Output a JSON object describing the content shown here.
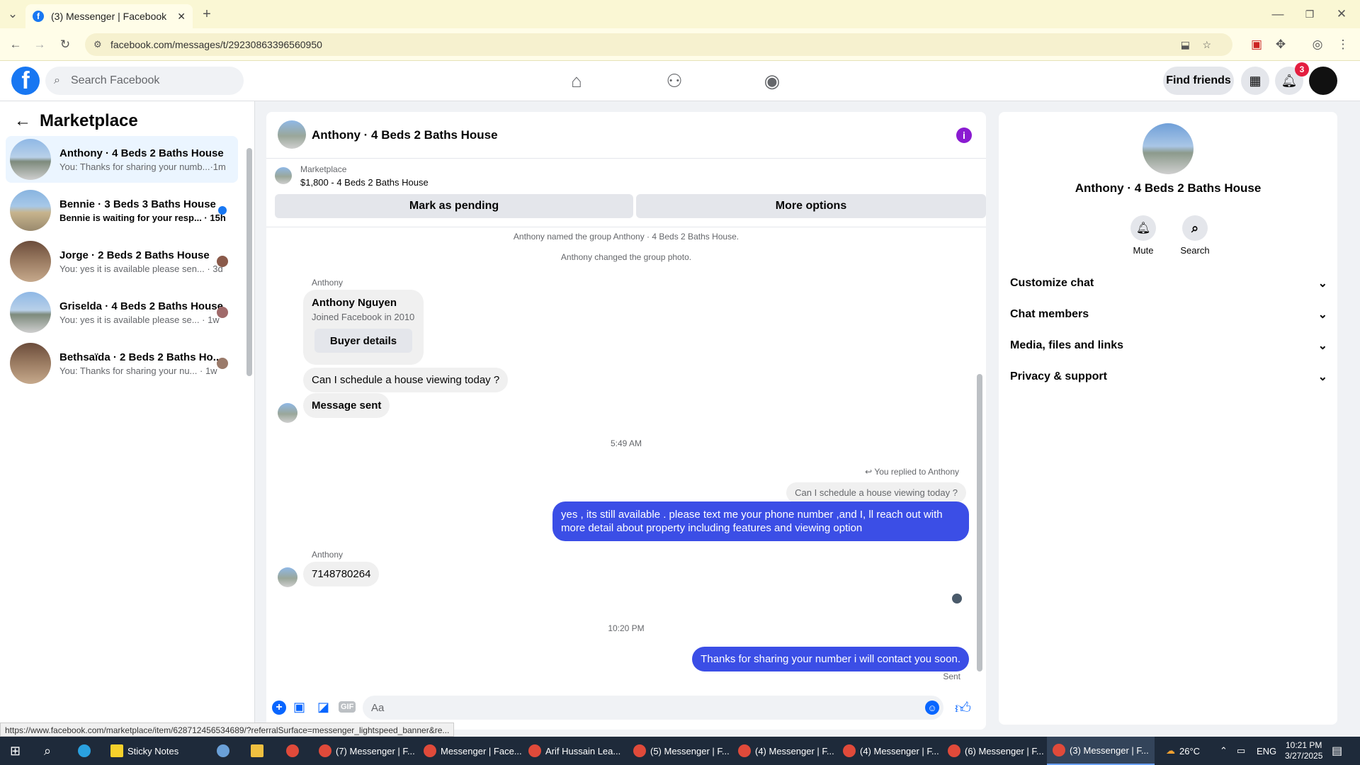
{
  "browser": {
    "tab_title": "(3) Messenger | Facebook",
    "url": "facebook.com/messages/t/29230863396560950",
    "status_url": "https://www.facebook.com/marketplace/item/628712456534689/?referralSurface=messenger_lightspeed_banner&re..."
  },
  "header": {
    "search_placeholder": "Search Facebook",
    "find_friends": "Find friends",
    "notif_count": "3"
  },
  "left": {
    "title": "Marketplace",
    "conversations": [
      {
        "name": "Anthony · 4 Beds 2 Baths House",
        "preview": "You: Thanks for sharing your numb...·1m"
      },
      {
        "name": "Bennie · 3 Beds 3 Baths House",
        "preview": "Bennie is waiting for your resp... · 15h"
      },
      {
        "name": "Jorge · 2 Beds 2 Baths House",
        "preview": "You: yes it is available please sen... · 3d"
      },
      {
        "name": "Griselda · 4 Beds 2 Baths House",
        "preview": "You: yes it is available please se... · 1w"
      },
      {
        "name": "Bethsaïda · 2 Beds 2 Baths Ho...",
        "preview": "You: Thanks for sharing your nu... · 1w"
      }
    ]
  },
  "chat": {
    "title": "Anthony · 4 Beds 2 Baths House",
    "listing_label": "Marketplace",
    "listing_detail": "$1,800 - 4 Beds 2 Baths House",
    "mark_pending": "Mark as pending",
    "more_options": "More options",
    "sys1": "Anthony named the group Anthony · 4 Beds 2 Baths House.",
    "sys2": "Anthony changed the group photo.",
    "sender1": "Anthony",
    "card_name": "Anthony Nguyen",
    "card_sub": "Joined Facebook in 2010",
    "buyer_details": "Buyer details",
    "msg1": "Can I schedule a house viewing today ?",
    "msg2": "Message sent",
    "time1": "5:49 AM",
    "replied": "You replied to Anthony",
    "quoted": "Can I schedule a house viewing today ?",
    "reply_line1": "yes , its still available . please text me your phone number ,and I,  ll reach out with",
    "reply_line2": "more detail about property including features and viewing option",
    "sender2": "Anthony",
    "msg3": "7148780264",
    "time2": "10:20 PM",
    "msg4": "Thanks for sharing your number i will contact you soon.",
    "sent": "Sent",
    "composer_placeholder": "Aa"
  },
  "right": {
    "name": "Anthony · 4 Beds 2 Baths House",
    "mute": "Mute",
    "search": "Search",
    "sections": [
      "Customize chat",
      "Chat members",
      "Media, files and links",
      "Privacy & support"
    ]
  },
  "taskbar": {
    "items": [
      "Sticky Notes",
      "(7) Messenger | F...",
      "Messenger | Face...",
      "Arif Hussain Lea...",
      "(5) Messenger | F...",
      "(4) Messenger | F...",
      "(4) Messenger | F...",
      "(6) Messenger | F...",
      "(3) Messenger | F..."
    ],
    "temp": "26°C",
    "lang": "ENG",
    "time": "10:21 PM",
    "date": "3/27/2025"
  },
  "colors": {
    "accent": "#1877f2",
    "my_bubble": "#3b4ee6",
    "info": "#8a1bd1"
  }
}
